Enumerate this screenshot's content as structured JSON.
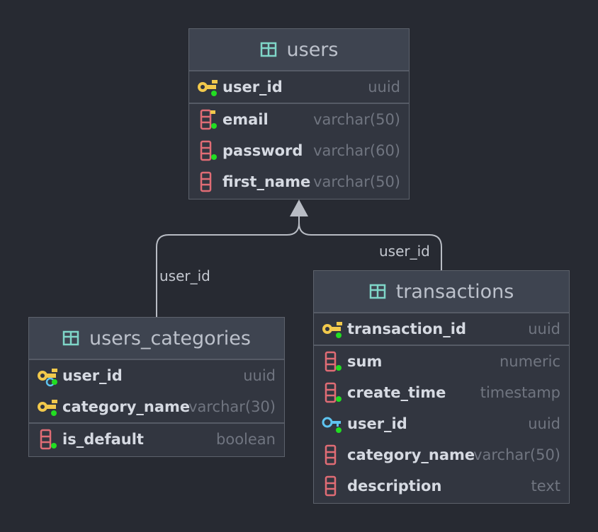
{
  "tables": {
    "users": {
      "title": "users",
      "pk": [
        {
          "name": "user_id",
          "type": "uuid",
          "icon": "primary-key-icon"
        }
      ],
      "cols": [
        {
          "name": "email",
          "type": "varchar(50)",
          "icon": "unique-column-icon"
        },
        {
          "name": "password",
          "type": "varchar(60)",
          "icon": "column-icon"
        },
        {
          "name": "first_name",
          "type": "varchar(50)",
          "icon": "column-icon"
        }
      ]
    },
    "users_categories": {
      "title": "users_categories",
      "pk": [
        {
          "name": "user_id",
          "type": "uuid",
          "icon": "primary-foreign-key-icon"
        },
        {
          "name": "category_name",
          "type": "varchar(30)",
          "icon": "primary-key-icon"
        }
      ],
      "cols": [
        {
          "name": "is_default",
          "type": "boolean",
          "icon": "column-icon"
        }
      ]
    },
    "transactions": {
      "title": "transactions",
      "pk": [
        {
          "name": "transaction_id",
          "type": "uuid",
          "icon": "primary-key-icon"
        }
      ],
      "cols": [
        {
          "name": "sum",
          "type": "numeric",
          "icon": "column-icon"
        },
        {
          "name": "create_time",
          "type": "timestamp",
          "icon": "column-icon"
        },
        {
          "name": "user_id",
          "type": "uuid",
          "icon": "foreign-key-icon"
        },
        {
          "name": "category_name",
          "type": "varchar(50)",
          "icon": "column-icon"
        },
        {
          "name": "description",
          "type": "text",
          "icon": "column-icon"
        }
      ]
    }
  },
  "relations": [
    {
      "from": "users_categories",
      "to": "users",
      "label": "user_id"
    },
    {
      "from": "transactions",
      "to": "users",
      "label": "user_id"
    }
  ],
  "colors": {
    "background": "#272a32",
    "key": "#f2c94c",
    "foreign_key": "#5ec4f0",
    "column": "#e06c75",
    "table_icon": "#7fd6c8",
    "not_null_dot": "#22dd22"
  }
}
